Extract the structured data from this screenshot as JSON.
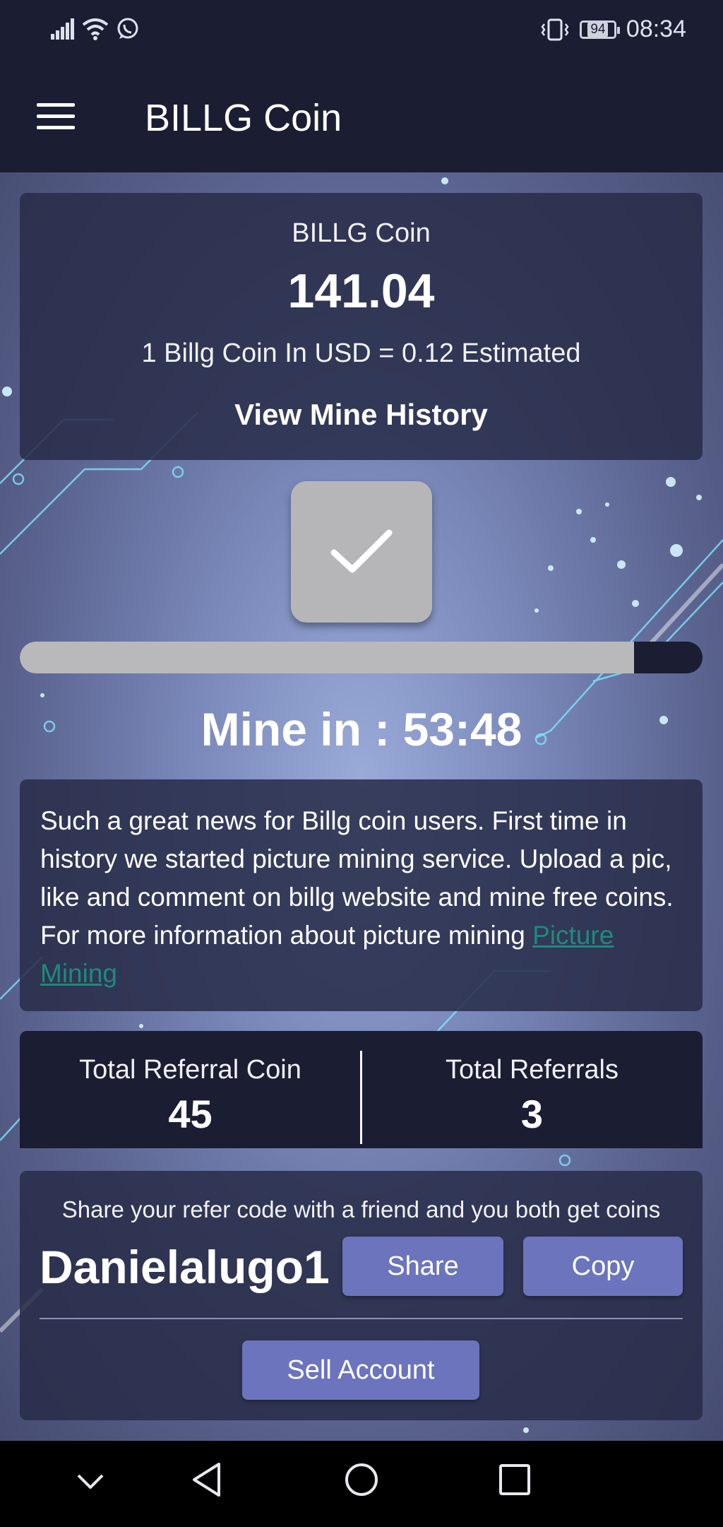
{
  "status_bar": {
    "battery": "94",
    "time": "08:34"
  },
  "app_bar": {
    "title": "BILLG Coin"
  },
  "balance_card": {
    "title": "BILLG Coin",
    "amount": "141.04",
    "rate_text": "1 Billg Coin In USD = 0.12 Estimated",
    "history_link": "View Mine History"
  },
  "mining": {
    "progress": 0.9,
    "countdown_text": "Mine in : 53:48"
  },
  "news": {
    "text": "Such a great news for Billg coin users. First time in history we started picture mining service. Upload a pic, like and comment on billg website and mine free coins. For more information about picture mining ",
    "link_text": "Picture Mining"
  },
  "referral_stats": {
    "coin_label": "Total Referral Coin",
    "coin_value": "45",
    "count_label": "Total Referrals",
    "count_value": "3"
  },
  "refer": {
    "message": "Share your refer code with a friend and you both get coins",
    "code": "Danielalugo1",
    "share_label": "Share",
    "copy_label": "Copy",
    "sell_label": "Sell Account"
  },
  "colors": {
    "bar_background": "#1b1d33",
    "card_background": "#282c48",
    "button_accent": "#6b74bc",
    "link": "#1f8a7a"
  },
  "icons": {
    "status_left": [
      "signal-icon",
      "wifi-icon",
      "whatsapp-icon"
    ],
    "status_right": [
      "vibrate-icon",
      "battery-icon"
    ],
    "nav": [
      "nav-hide-icon",
      "nav-back-icon",
      "nav-home-icon",
      "nav-recents-icon"
    ]
  }
}
